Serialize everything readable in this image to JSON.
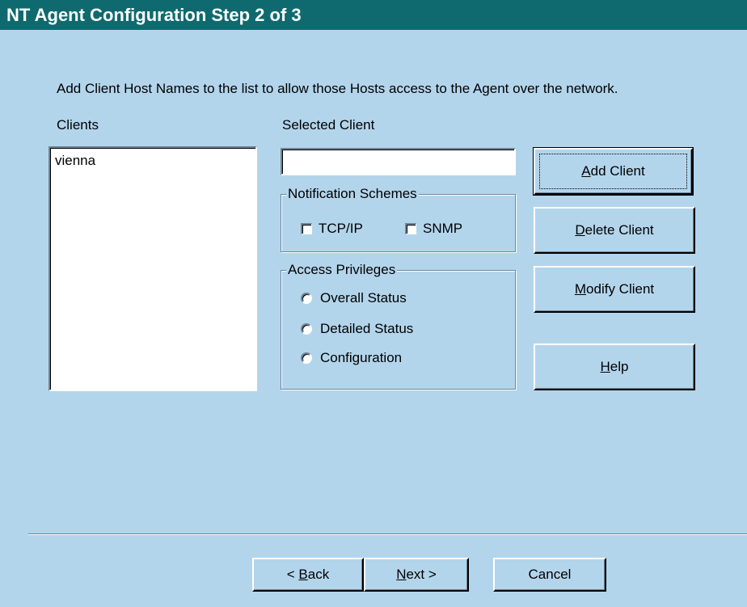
{
  "window": {
    "title": "NT Agent Configuration Step 2 of 3"
  },
  "intro_text": "Add Client Host Names to the list to allow those Hosts access to the Agent over the network.",
  "clients": {
    "label": "Clients",
    "items": [
      "vienna"
    ]
  },
  "selected_client": {
    "label": "Selected Client",
    "value": "",
    "placeholder": ""
  },
  "notification_schemes": {
    "legend": "Notification Schemes",
    "options": [
      {
        "label": "TCP/IP",
        "checked": false
      },
      {
        "label": "SNMP",
        "checked": false
      }
    ]
  },
  "access_privileges": {
    "legend": "Access Privileges",
    "options": [
      {
        "label": "Overall Status",
        "selected": false
      },
      {
        "label": "Detailed Status",
        "selected": false
      },
      {
        "label": "Configuration",
        "selected": false
      }
    ]
  },
  "actions": {
    "add_client": {
      "accel": "A",
      "rest": "dd Client"
    },
    "delete_client": {
      "accel": "D",
      "rest": "elete Client"
    },
    "modify_client": {
      "accel": "M",
      "rest": "odify Client"
    },
    "help": {
      "accel": "H",
      "rest": "elp"
    }
  },
  "nav": {
    "back": {
      "prefix": "< ",
      "accel": "B",
      "rest": "ack"
    },
    "next": {
      "accel": "N",
      "rest": "ext >"
    },
    "cancel": {
      "label": "Cancel"
    }
  },
  "colors": {
    "title_bar": "#0e6a6e",
    "background": "#b3d5ec"
  }
}
